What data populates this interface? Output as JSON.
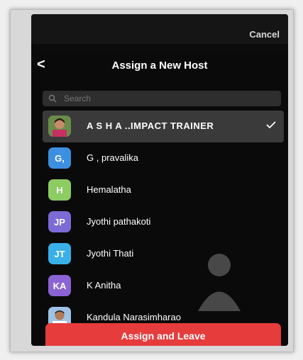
{
  "header": {
    "cancel_label": "Cancel",
    "title": "Assign a New Host",
    "back_icon": "<"
  },
  "search": {
    "placeholder": "Search"
  },
  "participants": [
    {
      "initials": "",
      "name": "A S H A ..IMPACT TRAINER",
      "color": "#b0455a",
      "photo": true,
      "selected": true
    },
    {
      "initials": "G,",
      "name": "G , pravalika",
      "color": "#3d8fe0",
      "photo": false,
      "selected": false
    },
    {
      "initials": "H",
      "name": "Hemalatha",
      "color": "#8ccc63",
      "photo": false,
      "selected": false
    },
    {
      "initials": "JP",
      "name": "Jyothi pathakoti",
      "color": "#7c6ad6",
      "photo": false,
      "selected": false
    },
    {
      "initials": "JT",
      "name": "Jyothi Thati",
      "color": "#3ab0e8",
      "photo": false,
      "selected": false
    },
    {
      "initials": "KA",
      "name": "K Anitha",
      "color": "#8b63d4",
      "photo": false,
      "selected": false
    },
    {
      "initials": "",
      "name": "Kandula Narasimharao",
      "color": "#4a7bb5",
      "photo": true,
      "selected": false
    }
  ],
  "footer": {
    "assign_label": "Assign and Leave"
  },
  "colors": {
    "accent": "#e63c3c",
    "background": "#0a0a0a",
    "selected_row": "#3a3a3a"
  }
}
